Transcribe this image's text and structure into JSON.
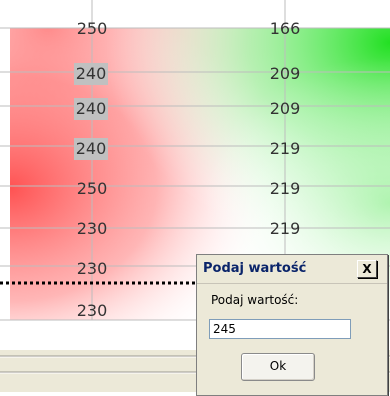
{
  "table": {
    "left_column": [
      "250",
      "240",
      "240",
      "240",
      "250",
      "230",
      "230",
      "230"
    ],
    "right_column": [
      "166",
      "209",
      "209",
      "219",
      "219",
      "219"
    ],
    "selected_left_rows": [
      1,
      2,
      3
    ]
  },
  "dialog": {
    "title": "Podaj wartość",
    "close_label": "X",
    "prompt": "Podaj wartość:",
    "input_value": "245",
    "ok_label": "Ok"
  },
  "colors": {
    "red_zone": "#ff5a5a",
    "green_zone": "#33dd33",
    "grid_line": "#bdbdbd",
    "dotted_line": "#000000"
  }
}
